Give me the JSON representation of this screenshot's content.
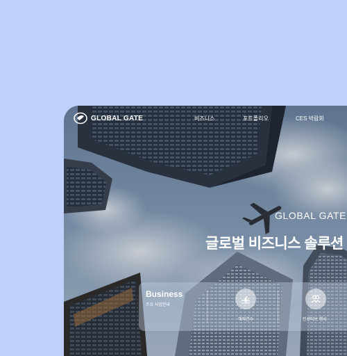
{
  "nav": {
    "logo_text": "GLOBAL GATE",
    "items": [
      "비즈니스",
      "포트폴리오",
      "CES 박람회"
    ]
  },
  "hero": {
    "brand": "GLOBAL GATE",
    "title": "글로벌 비즈니스 솔루션"
  },
  "business_card": {
    "title": "Business",
    "subtitle": "주요 사업안내",
    "services": [
      {
        "label": "해외연수",
        "icon": "airplane-icon"
      },
      {
        "label": "인센티브 행사",
        "icon": "people-icon"
      }
    ]
  },
  "colors": {
    "page_background": "#bfd0fb",
    "text": "#ffffff"
  }
}
